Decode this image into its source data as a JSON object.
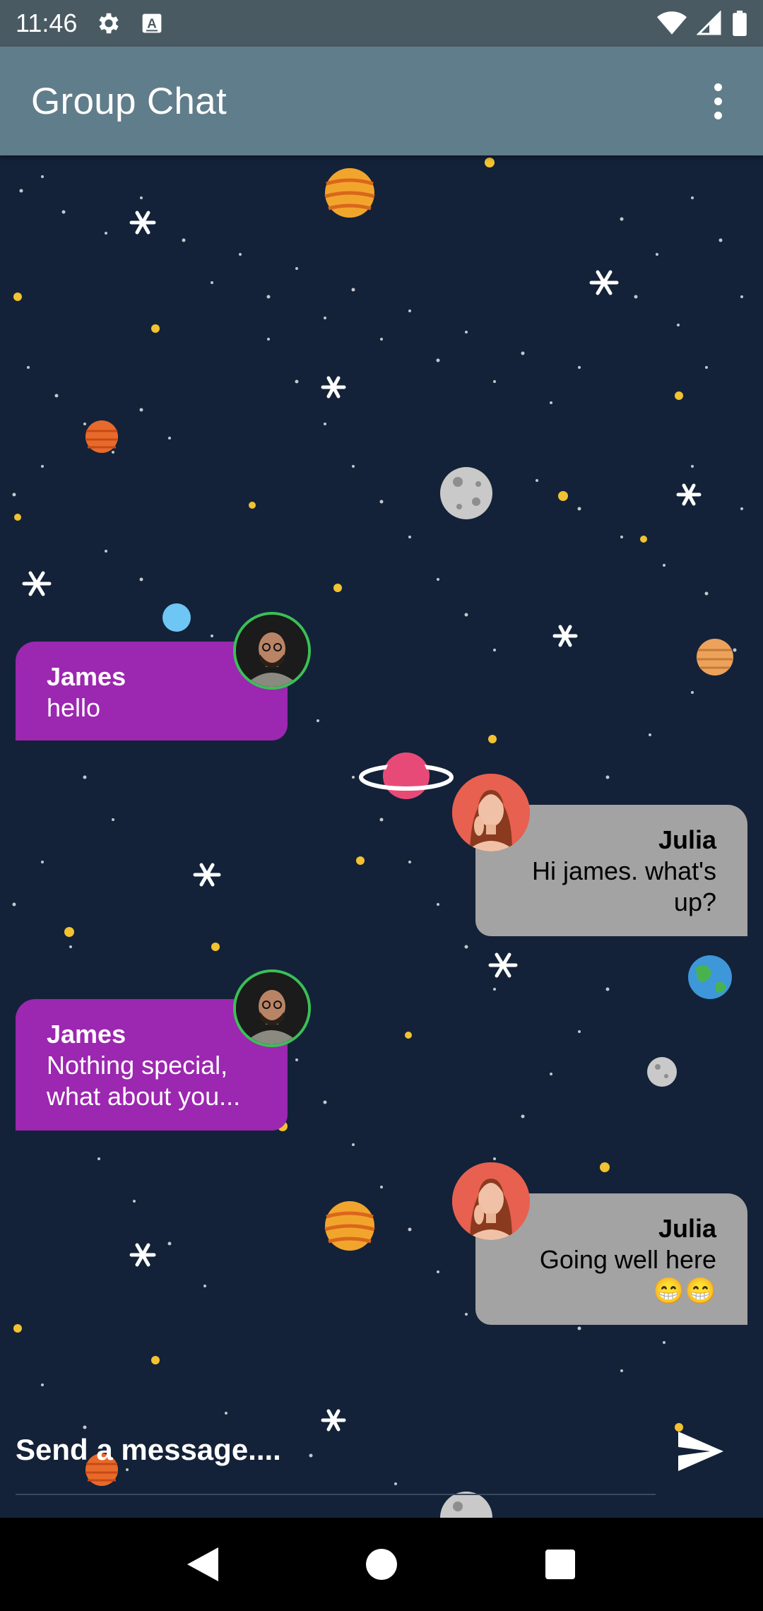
{
  "status_bar": {
    "time": "11:46",
    "icons": [
      "settings-icon",
      "keyboard-a-icon",
      "wifi-icon",
      "signal-icon",
      "battery-icon"
    ]
  },
  "app_bar": {
    "title": "Group Chat",
    "menu_icon": "more-vert-icon"
  },
  "colors": {
    "app_bar": "#607d8b",
    "status_bar": "#4a5a63",
    "chat_background": "#132238",
    "sent_bubble": "#9c27b0",
    "received_bubble": "#a3a3a3",
    "avatar_ring": "#3bbf57"
  },
  "messages": [
    {
      "sender": "James",
      "text": "hello",
      "side": "left"
    },
    {
      "sender": "Julia",
      "text": "Hi james. what's up?",
      "side": "right"
    },
    {
      "sender": "James",
      "text": "Nothing special, what about you...",
      "side": "left"
    },
    {
      "sender": "Julia",
      "text": "Going well here 😁😁",
      "side": "right"
    }
  ],
  "composer": {
    "placeholder": "Send a message....",
    "value": "",
    "send_icon": "send-icon"
  },
  "nav_bar": {
    "icons": [
      "back-icon",
      "home-icon",
      "recents-icon"
    ]
  }
}
